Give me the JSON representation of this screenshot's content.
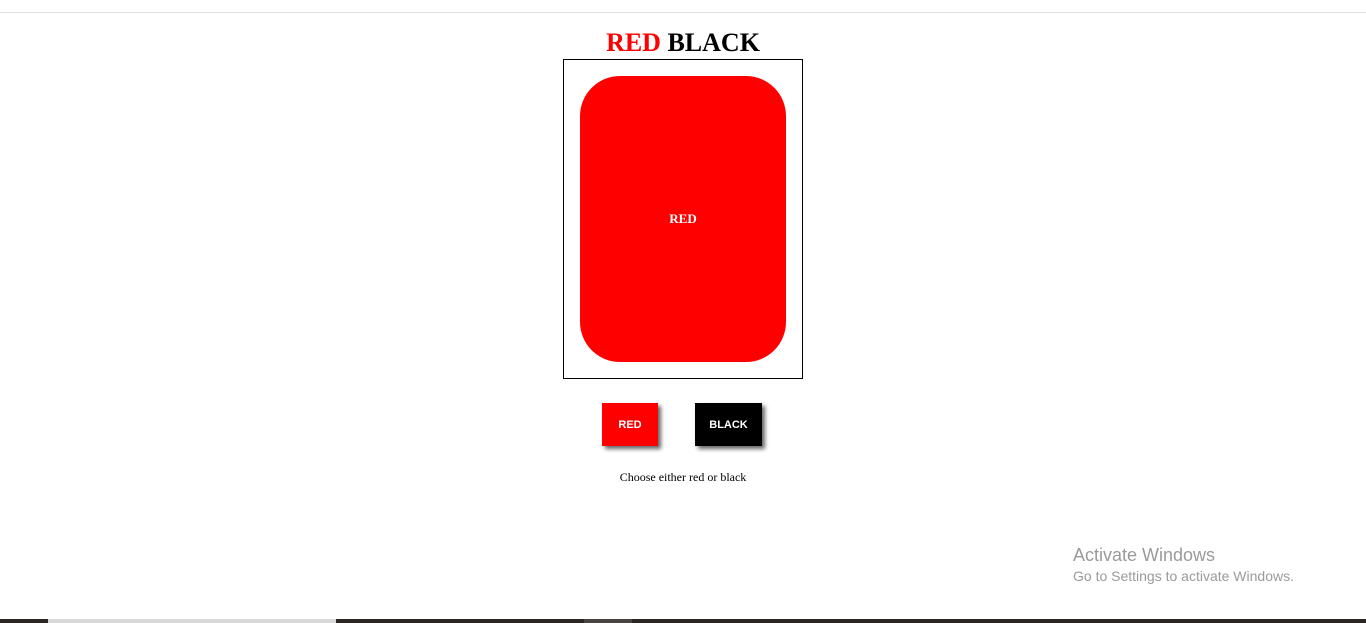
{
  "game": {
    "title_red": "RED",
    "title_black": "BLACK",
    "card_label": "RED",
    "buttons": {
      "red_label": "RED",
      "black_label": "BLACK"
    },
    "message": "Choose either red or black"
  },
  "watermark": {
    "title": "Activate Windows",
    "subtitle": "Go to Settings to activate Windows."
  },
  "colors": {
    "red": "#ff0000",
    "black": "#000000"
  }
}
